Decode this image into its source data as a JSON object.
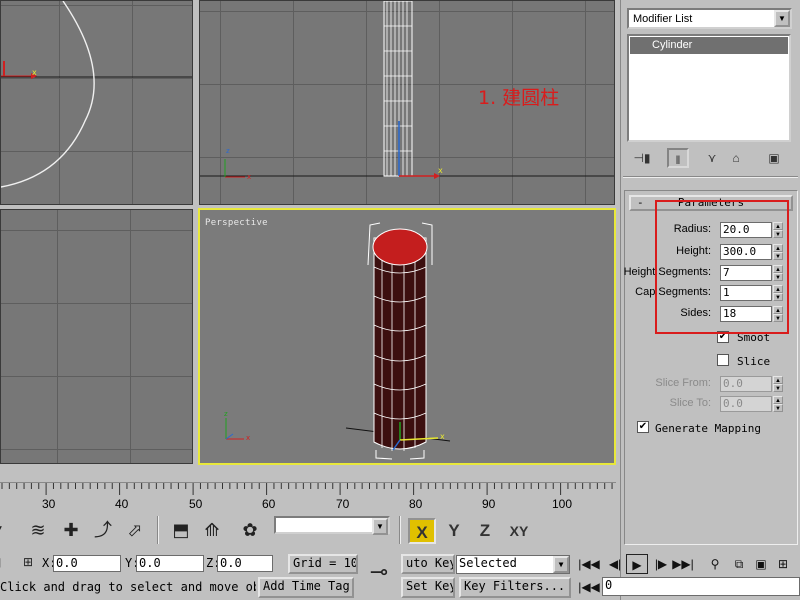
{
  "viewports": {
    "perspective_label": "Perspective",
    "annotation": "1. 建圆柱"
  },
  "command_panel": {
    "modifier_list": "Modifier List",
    "stack_item": "Cylinder",
    "rollout_title": "Parameters",
    "rollout_toggle": "-",
    "params": {
      "radius": {
        "label": "Radius:",
        "value": "20.0"
      },
      "height": {
        "label": "Height:",
        "value": "300.0"
      },
      "height_segments": {
        "label": "Height Segments:",
        "value": "7"
      },
      "cap_segments": {
        "label": "Cap Segments:",
        "value": "1"
      },
      "sides": {
        "label": "Sides:",
        "value": "18"
      }
    },
    "smooth_label": "Smoot",
    "slice_label": "Slice",
    "slice_from": {
      "label": "Slice From:",
      "value": "0.0"
    },
    "slice_to": {
      "label": "Slice To:",
      "value": "0.0"
    },
    "gen_mapping_label": "Generate Mapping"
  },
  "timeline": {
    "ticks": [
      "30",
      "40",
      "50",
      "60",
      "70",
      "80",
      "90",
      "100"
    ]
  },
  "axis": {
    "x": "X",
    "y": "Y",
    "z": "Z",
    "xy": "XY"
  },
  "status": {
    "x_label": "X:",
    "x_value": "0.0",
    "y_label": "Y:",
    "y_value": "0.0",
    "z_label": "Z:",
    "z_value": "0.0",
    "grid": "Grid = 10",
    "auto_key": "uto Key",
    "selected": "Selected",
    "set_key": "Set Key",
    "key_filters": "Key Filters...",
    "prompt": "Click and drag to select and move obj",
    "add_time_tag": "Add Time Tag",
    "frame": "0"
  },
  "colors": {
    "viewport_bg": "#777777",
    "active_border": "#e8e83a",
    "cylinder_red": "#c41e1e",
    "annotation_red": "#d91c1c"
  }
}
